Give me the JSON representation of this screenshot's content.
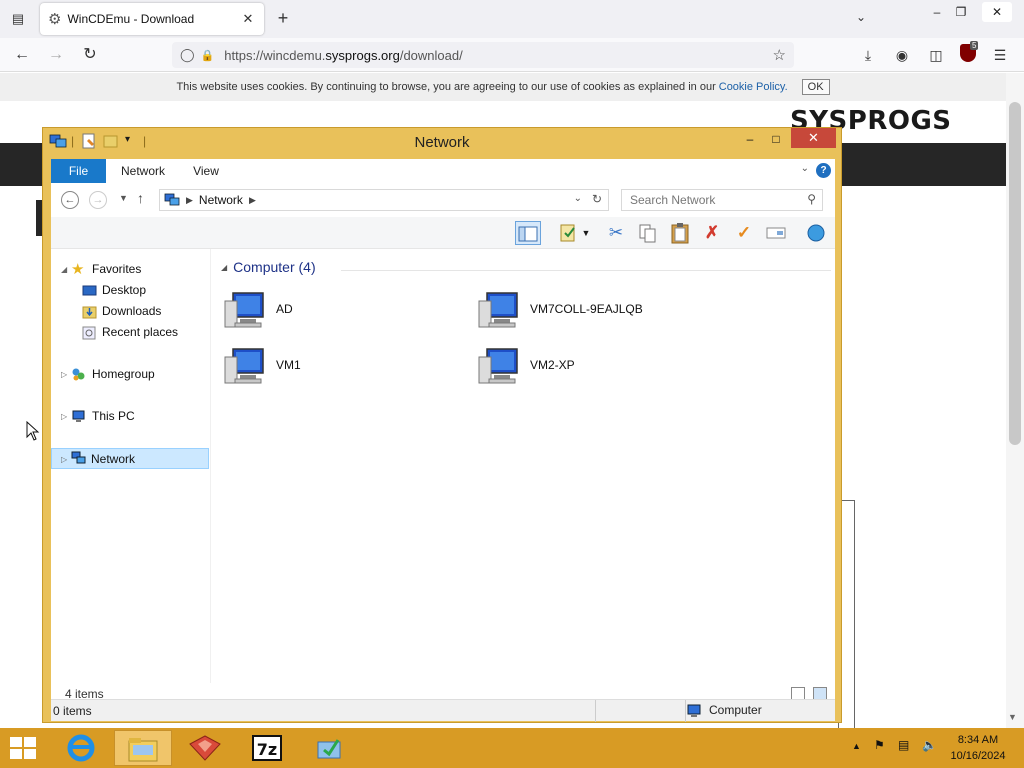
{
  "browser": {
    "tab_title": "WinCDEmu - Download",
    "url_prefix": "https://wincdemu.",
    "url_domain": "sysprogs.org",
    "url_path": "/download/",
    "ublock_count": "5"
  },
  "page": {
    "cookie_text": "This website uses cookies. By continuing to browse, you are agreeing to our use of cookies as explained in our",
    "cookie_link": "Cookie Policy.",
    "cookie_ok": "OK",
    "logo": "SYSPROGS"
  },
  "explorer": {
    "title": "Network",
    "ribbon_tabs": [
      "File",
      "Network",
      "View"
    ],
    "breadcrumb": "Network",
    "search_placeholder": "Search Network",
    "nav": {
      "favorites": "Favorites",
      "desktop": "Desktop",
      "downloads": "Downloads",
      "recent": "Recent places",
      "homegroup": "Homegroup",
      "thispc": "This PC",
      "network": "Network"
    },
    "group_title": "Computer (4)",
    "computers": [
      "AD",
      "VM7COLL-9EAJLQB",
      "VM1",
      "VM2-XP"
    ],
    "item_count": "4 items",
    "selected_count": "0 items",
    "zone": "Computer"
  },
  "taskbar": {
    "time": "8:34 AM",
    "date": "10/16/2024"
  },
  "colors": {
    "window_frame": "#e9c15a",
    "taskbar": "#d89b24",
    "file_tab": "#1979ca",
    "close_button": "#c7483a"
  }
}
